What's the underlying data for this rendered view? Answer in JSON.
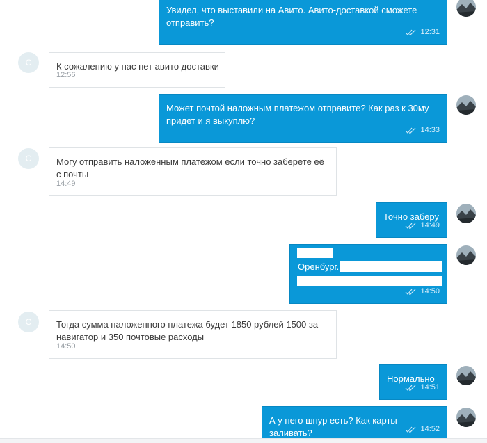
{
  "chat": {
    "incoming_avatar_letter": "С",
    "messages": [
      {
        "dir": "out",
        "text": "Увидел, что выставили на Авито. Авито-доставкой сможете\nотправить?",
        "time": "12:31"
      },
      {
        "dir": "in",
        "text": "К сожалению у нас нет авито доставки",
        "time": "12:56"
      },
      {
        "dir": "out",
        "text": "Может почтой наложным платежом отправите? Как раз к 30му\nпридет и я выкуплю?",
        "time": "14:33"
      },
      {
        "dir": "in",
        "text": "Могу отправить наложенным платежом если точно заберете её\nс почты",
        "time": "14:49"
      },
      {
        "dir": "out",
        "text": "Точно заберу",
        "time": "14:49"
      },
      {
        "dir": "out",
        "text": "Оренбург.",
        "time": "14:50"
      },
      {
        "dir": "in",
        "text": "Тогда сумма наложенного платежа будет 1850 рублей 1500 за\nнавигатор и 350 почтовые расходы",
        "time": "14:50"
      },
      {
        "dir": "out",
        "text": "Нормально",
        "time": "14:51"
      },
      {
        "dir": "out",
        "text": "А у него шнур есть? Как карты заливать?",
        "time": "14:52"
      }
    ]
  },
  "colors": {
    "outgoing_bubble": "#0a98d8",
    "incoming_border": "#dfe3e6",
    "incoming_avatar": "#e3edf1"
  },
  "icons": {
    "read_receipt": "double-check-icon",
    "outgoing_avatar": "landscape-photo-avatar"
  }
}
